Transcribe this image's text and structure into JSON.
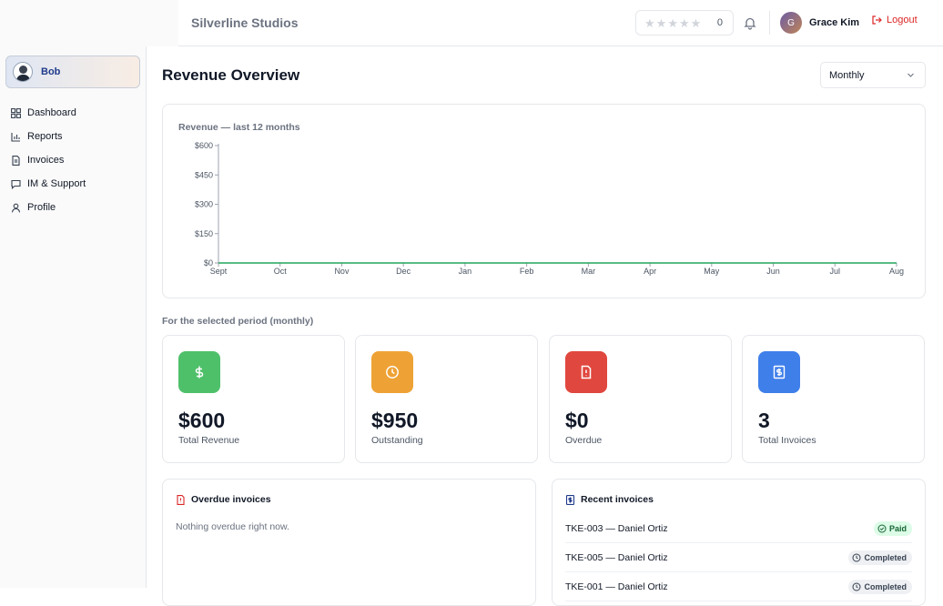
{
  "header": {
    "brand": "Silverline Studios",
    "rating_count": "0",
    "user_name": "Grace Kim",
    "user_initial": "G",
    "logout_label": "Logout"
  },
  "sidebar": {
    "user_name": "Bob",
    "items": [
      {
        "label": "Dashboard",
        "icon": "grid-icon"
      },
      {
        "label": "Reports",
        "icon": "bar-chart-icon"
      },
      {
        "label": "Invoices",
        "icon": "document-icon"
      },
      {
        "label": "IM & Support",
        "icon": "chat-icon"
      },
      {
        "label": "Profile",
        "icon": "user-icon"
      }
    ]
  },
  "main": {
    "title": "Revenue Overview",
    "period_select": "Monthly",
    "period_caption": "For the selected period (monthly)"
  },
  "chart_data": {
    "type": "line",
    "title": "Revenue — last 12 months",
    "x": [
      "Sept",
      "Oct",
      "Nov",
      "Dec",
      "Jan",
      "Feb",
      "Mar",
      "Apr",
      "May",
      "Jun",
      "Jul",
      "Aug"
    ],
    "y_ticks": [
      "$0",
      "$150",
      "$300",
      "$450",
      "$600"
    ],
    "ylim": [
      0,
      600
    ],
    "series": [
      {
        "values": [
          0,
          0,
          0,
          0,
          0,
          0,
          0,
          0,
          0,
          0,
          0,
          0
        ],
        "color": "#22a55a"
      }
    ],
    "grid": false
  },
  "stats": [
    {
      "value": "$600",
      "label": "Total Revenue",
      "color": "#4fc06a",
      "icon": "dollar-icon"
    },
    {
      "value": "$950",
      "label": "Outstanding",
      "color": "#eea235",
      "icon": "clock-icon"
    },
    {
      "value": "$0",
      "label": "Overdue",
      "color": "#e0473e",
      "icon": "alert-file-icon"
    },
    {
      "value": "3",
      "label": "Total Invoices",
      "color": "#3f7fea",
      "icon": "invoice-icon"
    }
  ],
  "overdue_panel": {
    "title": "Overdue invoices",
    "empty_text": "Nothing overdue right now."
  },
  "recent_panel": {
    "title": "Recent invoices",
    "rows": [
      {
        "label": "TKE-003 — Daniel Ortiz",
        "status": "Paid"
      },
      {
        "label": "TKE-005 — Daniel Ortiz",
        "status": "Completed"
      },
      {
        "label": "TKE-001 — Daniel Ortiz",
        "status": "Completed"
      }
    ]
  }
}
